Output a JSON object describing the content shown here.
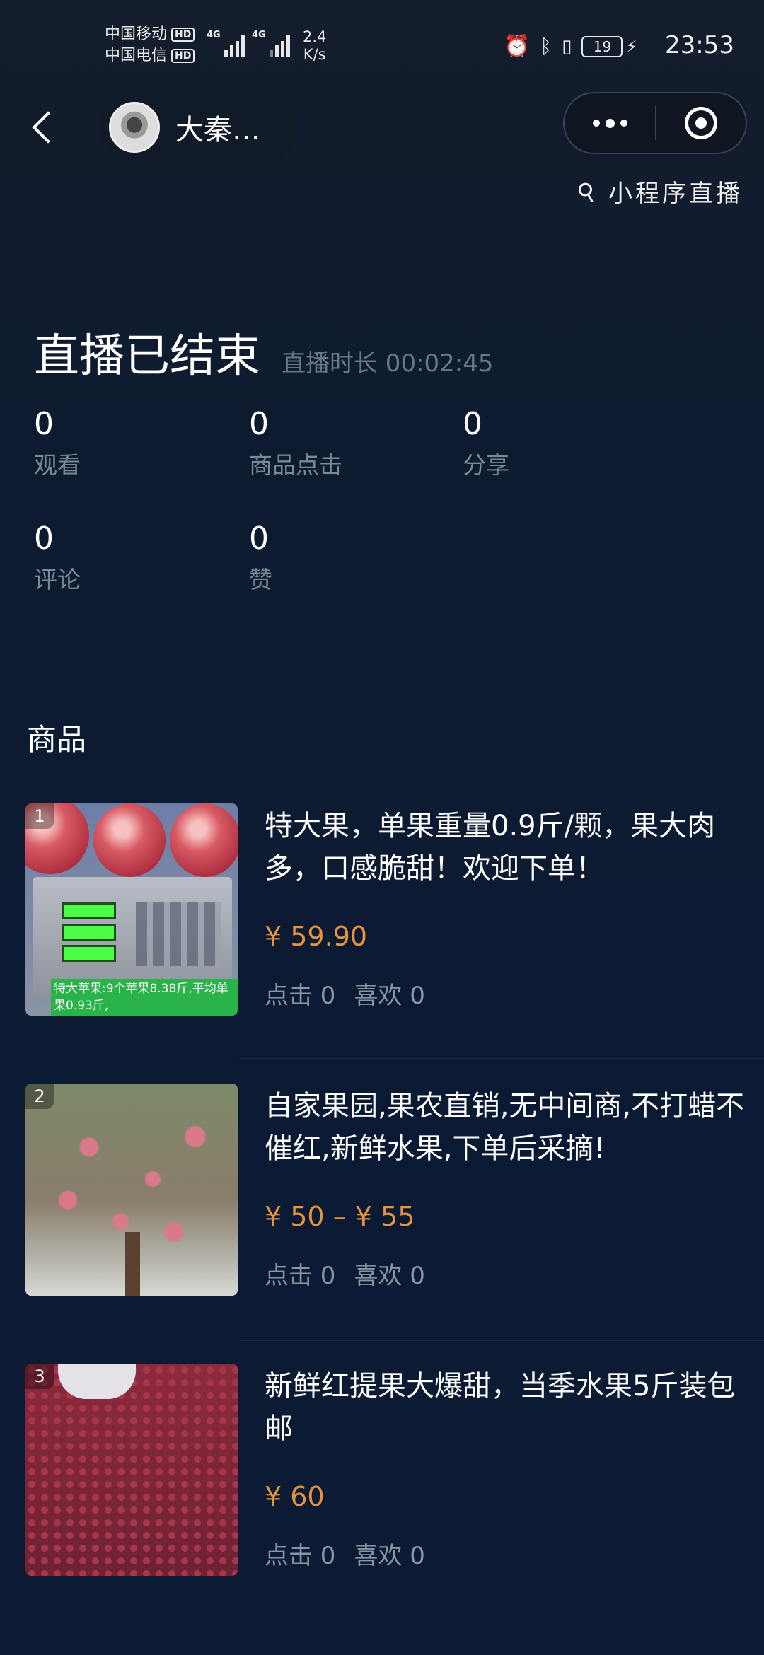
{
  "status_bar": {
    "carrier1": "中国移动",
    "carrier2": "中国电信",
    "hd": "HD",
    "net1": "4G",
    "net2": "4G",
    "speed_value": "2.4",
    "speed_unit": "K/s",
    "battery": "19",
    "time": "23:53"
  },
  "nav": {
    "host_name": "大秦…",
    "mini_live_label": "小程序直播"
  },
  "live": {
    "ended_title": "直播已结束",
    "duration": "直播时长 00:02:45",
    "stats": [
      {
        "value": "0",
        "label": "观看"
      },
      {
        "value": "0",
        "label": "商品点击"
      },
      {
        "value": "0",
        "label": "分享"
      },
      {
        "value": "0",
        "label": "评论"
      },
      {
        "value": "0",
        "label": "赞"
      }
    ]
  },
  "products_section": {
    "title": "商品",
    "items": [
      {
        "index": "1",
        "title": "特大果，单果重量0.9斤/颗，果大肉多，口感脆甜！欢迎下单！",
        "price": "¥ 59.90",
        "clicks": "点击 0",
        "likes": "喜欢 0",
        "image_caption": "特大苹果:9个苹果8.38斤,平均单果0.93斤,"
      },
      {
        "index": "2",
        "title": "自家果园,果农直销,无中间商,不打蜡不催红,新鲜水果,下单后采摘!",
        "price": "¥ 50 – ¥ 55",
        "clicks": "点击 0",
        "likes": "喜欢 0"
      },
      {
        "index": "3",
        "title": "新鲜红提果大爆甜，当季水果5斤装包邮",
        "price": "¥ 60",
        "clicks": "点击 0",
        "likes": "喜欢 0"
      }
    ]
  },
  "colors": {
    "price": "#e5953c",
    "muted": "#7c8797",
    "background": "#0b1a33"
  }
}
